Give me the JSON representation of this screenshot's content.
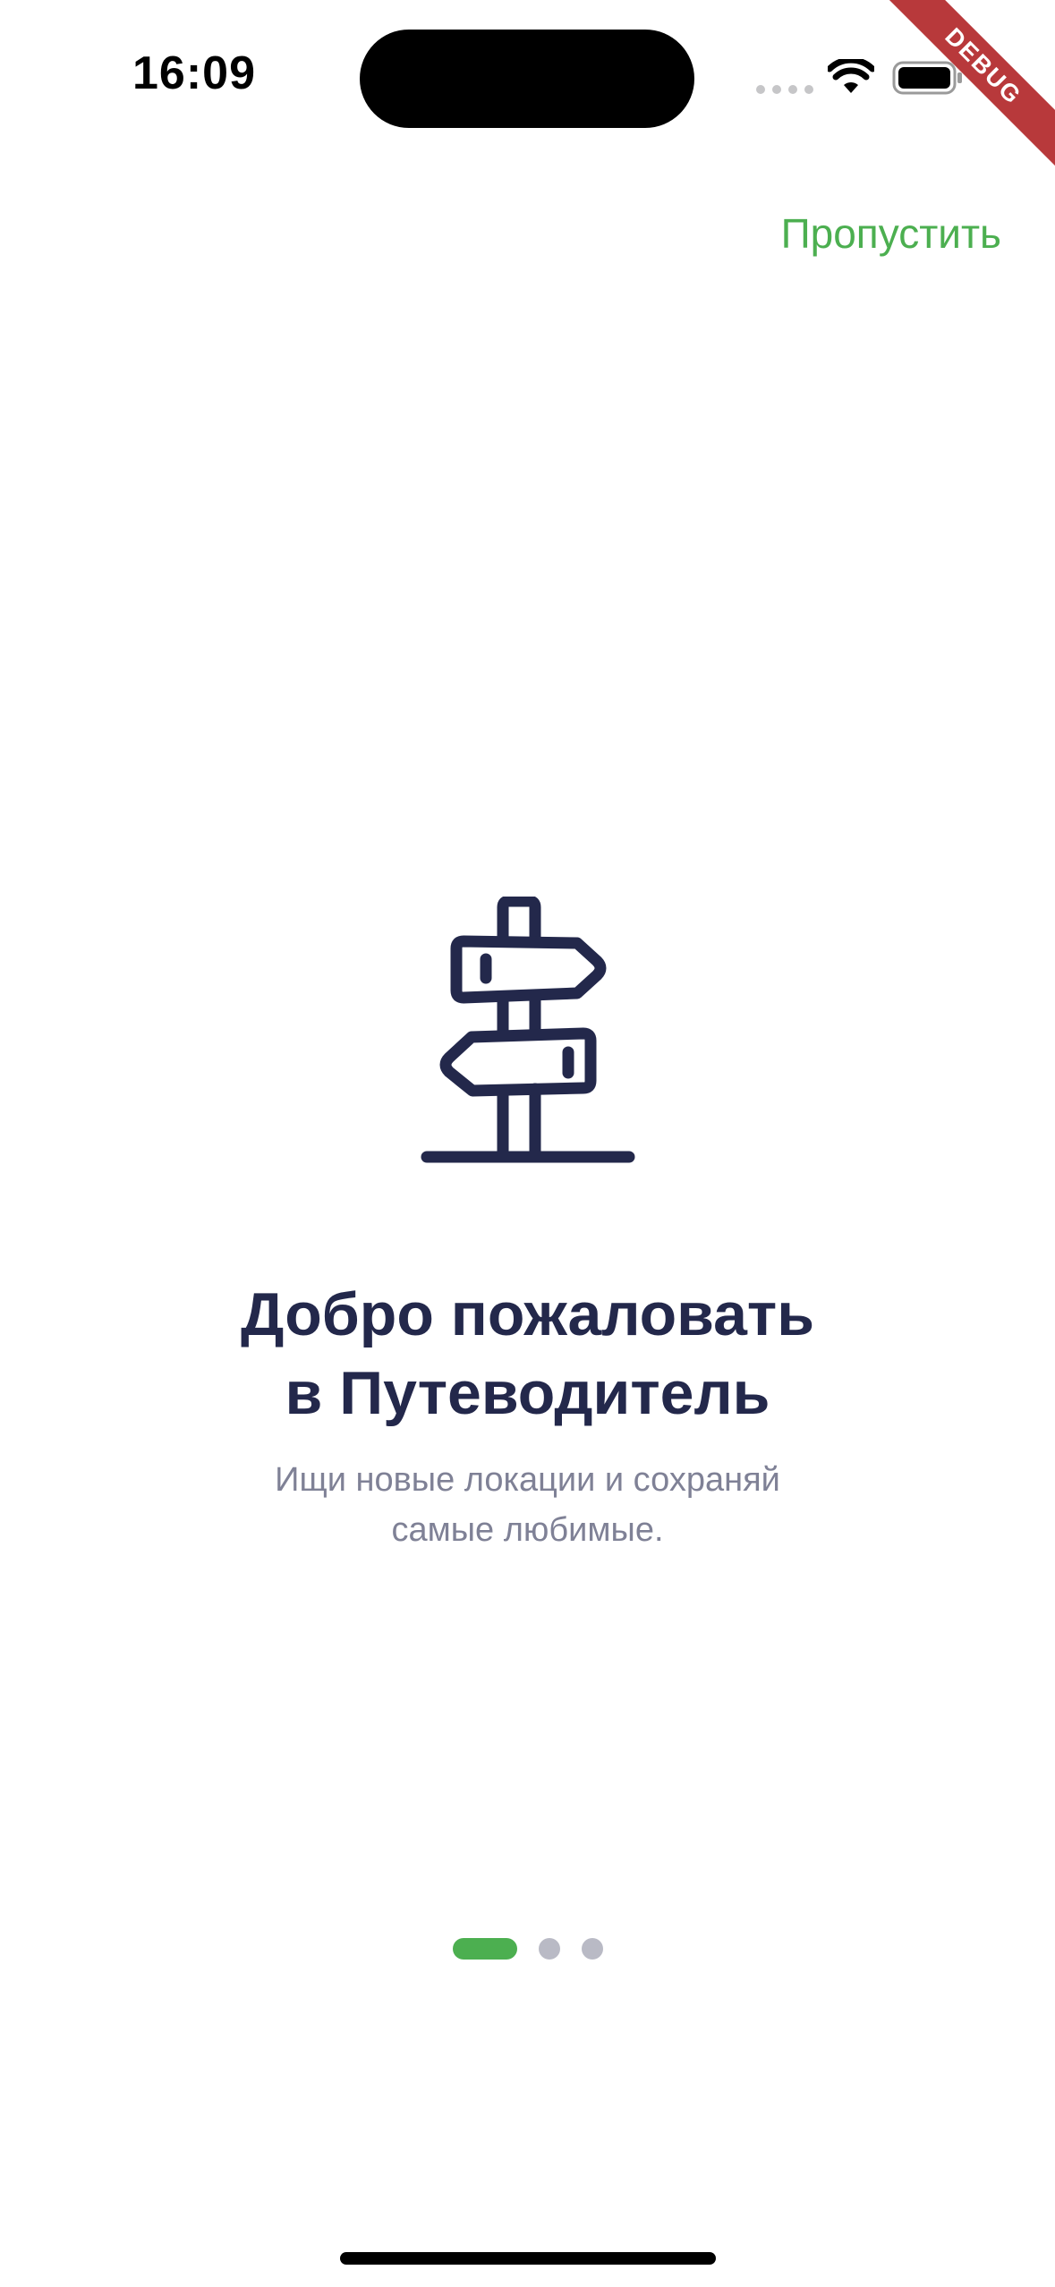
{
  "status_bar": {
    "time": "16:09"
  },
  "debug_banner": "DEBUG",
  "skip_label": "Пропустить",
  "onboarding": {
    "illustration_icon": "signpost-icon",
    "title_line1": "Добро пожаловать",
    "title_line2": "в Путеводитель",
    "subtitle_line1": "Ищи новые локации и сохраняй",
    "subtitle_line2": "самые любимые."
  },
  "pager": {
    "pages_total": 3,
    "current_page": 1
  },
  "colors": {
    "accent": "#4caf50",
    "title": "#23284b",
    "subtitle": "#7f8196",
    "inactive_dot": "#b9bac5",
    "debug_ribbon": "#b8393b"
  }
}
